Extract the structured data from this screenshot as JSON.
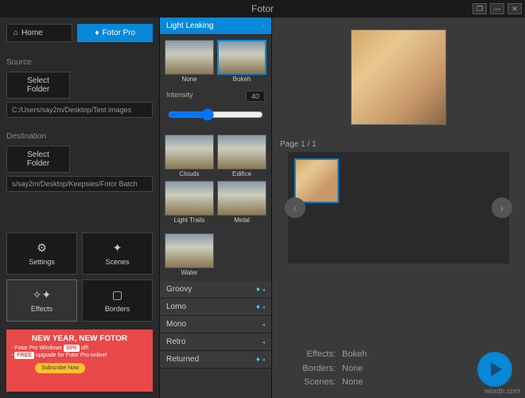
{
  "window": {
    "title": "Fotor"
  },
  "header": {
    "home": "Home",
    "pro": "Fotor Pro"
  },
  "source": {
    "label": "Source",
    "select": "Select Folder",
    "path": "C:/Users/say2m/Desktop/Test images"
  },
  "destination": {
    "label": "Destination",
    "select": "Select Folder",
    "path": "s/say2m/Desktop/Keepsies/Fotor Batch"
  },
  "modes": {
    "settings": "Settings",
    "scenes": "Scenes",
    "effects": "Effects",
    "borders": "Borders"
  },
  "promo": {
    "title": "NEW YEAR, NEW FOTOR",
    "line1a": "- Fotor Pro Windows",
    "line1b": "30%",
    "line1c": "off!",
    "line2a": "-",
    "line2b": "FREE",
    "line2c": "upgrade for Fotor Pro online!",
    "subscribe": "Subscribe Now"
  },
  "effects": {
    "active_category": "Light Leaking",
    "intensity_label": "Intensity",
    "intensity_value": "40",
    "thumbs_top": [
      "None",
      "Bokeh"
    ],
    "thumbs_mid": [
      "Clouds",
      "Edifice",
      "Light Trails",
      "Metal"
    ],
    "thumbs_bottom": [
      "Water"
    ],
    "categories": [
      "Groovy",
      "Lomo",
      "Mono",
      "Retro",
      "Returned"
    ]
  },
  "main": {
    "page": "Page 1 / 1",
    "info": {
      "effects_k": "Effects:",
      "effects_v": "Bokeh",
      "borders_k": "Borders:",
      "borders_v": "None",
      "scenes_k": "Scenes:",
      "scenes_v": "None"
    }
  },
  "watermark": "wsxdn.com"
}
